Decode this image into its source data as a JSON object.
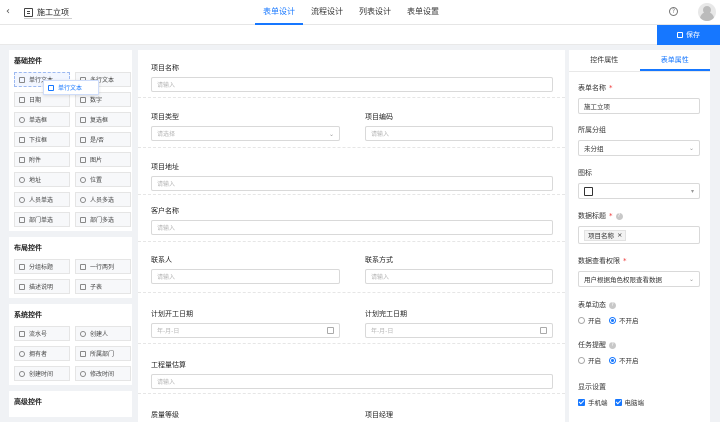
{
  "header": {
    "back_icon": "chevron-left-icon",
    "app_title": "施工立项",
    "tabs": [
      "表单设计",
      "流程设计",
      "列表设计",
      "表单设置"
    ],
    "active_tab": 0,
    "help_icon": "help-circle-icon",
    "save_label": "保存",
    "accent_color": "#1677ff"
  },
  "palette": {
    "sections": [
      {
        "title": "基础控件",
        "items": [
          "单行文本",
          "多行文本",
          "日期",
          "数字",
          "单选框",
          "复选框",
          "下拉框",
          "是/否",
          "附件",
          "图片",
          "地址",
          "位置",
          "人员单选",
          "人员多选",
          "部门单选",
          "部门多选"
        ]
      },
      {
        "title": "布局控件",
        "items": [
          "分组标题",
          "一行两列",
          "描述说明",
          "子表"
        ]
      },
      {
        "title": "系统控件",
        "items": [
          "流水号",
          "创建人",
          "拥有者",
          "所属部门",
          "创建时间",
          "修改时间"
        ]
      },
      {
        "title": "高级控件",
        "items": []
      }
    ],
    "drag_ghost": "单行文本"
  },
  "canvas": {
    "fields": {
      "project_name": {
        "label": "项目名称",
        "placeholder": "请输入"
      },
      "project_type": {
        "label": "项目类型",
        "placeholder": "请选择"
      },
      "project_code": {
        "label": "项目编码",
        "placeholder": "请输入"
      },
      "project_address": {
        "label": "项目地址",
        "placeholder": "请输入"
      },
      "customer_name": {
        "label": "客户名称",
        "placeholder": "请输入"
      },
      "contact": {
        "label": "联系人",
        "placeholder": "请输入"
      },
      "contact_method": {
        "label": "联系方式",
        "placeholder": "请输入"
      },
      "plan_start": {
        "label": "计划开工日期",
        "placeholder": "年-月-日"
      },
      "plan_end": {
        "label": "计划完工日期",
        "placeholder": "年-月-日"
      },
      "quantity_estimate": {
        "label": "工程量估算",
        "placeholder": "请输入"
      },
      "quality_level": {
        "label": "质量等级"
      },
      "project_manager": {
        "label": "项目经理"
      }
    }
  },
  "properties": {
    "tabs": [
      "控件属性",
      "表单属性"
    ],
    "active_tab": 1,
    "form_name": {
      "label": "表单名称",
      "value": "施工立项"
    },
    "group": {
      "label": "所属分组",
      "value": "未分组"
    },
    "icon": {
      "label": "图标",
      "icon": "form-icon"
    },
    "data_title": {
      "label": "数据标题",
      "tag": "项目名称"
    },
    "view_permission": {
      "label": "数据查看权限",
      "value": "用户根据角色权限查看数据"
    },
    "form_dynamic": {
      "label": "表单动态",
      "options": [
        "开启",
        "不开启"
      ],
      "selected": 1
    },
    "task_reminder": {
      "label": "任务提醒",
      "options": [
        "开启",
        "不开启"
      ],
      "selected": 1
    },
    "display": {
      "label": "显示设置",
      "options": [
        "手机端",
        "电脑端"
      ],
      "checked": [
        true,
        true
      ]
    }
  }
}
